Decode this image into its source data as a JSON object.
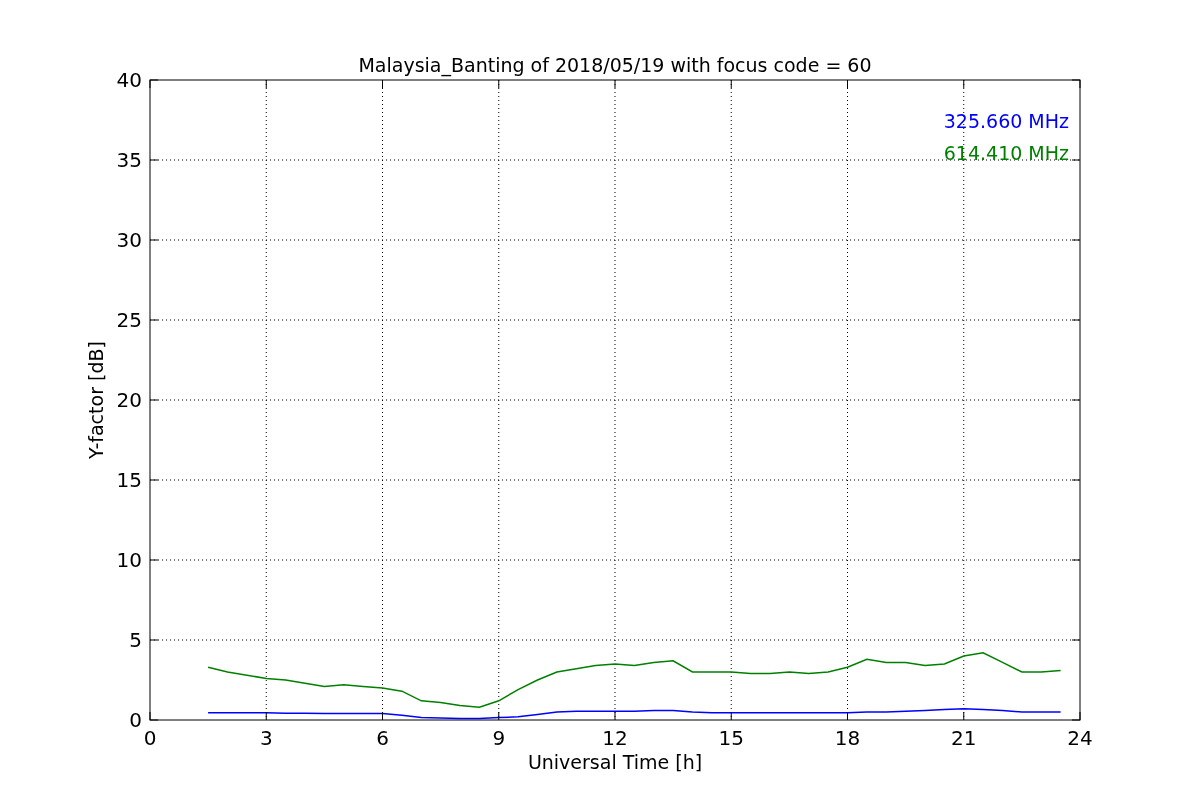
{
  "chart_data": {
    "type": "line",
    "title": "Malaysia_Banting of 2018/05/19 with focus code = 60",
    "xlabel": "Universal Time [h]",
    "ylabel": "Y-factor [dB]",
    "x": [
      1.5,
      2,
      2.5,
      3,
      3.5,
      4,
      4.5,
      5,
      5.5,
      6,
      6.5,
      7,
      7.5,
      8,
      8.5,
      9,
      9.5,
      10,
      10.5,
      11,
      11.5,
      12,
      12.5,
      13,
      13.5,
      14,
      14.5,
      15,
      15.5,
      16,
      16.5,
      17,
      17.5,
      18,
      18.5,
      19,
      19.5,
      20,
      20.5,
      21,
      21.5,
      22,
      22.5,
      23,
      23.5
    ],
    "series": [
      {
        "name": "325.660 MHz",
        "color": "#0000ff",
        "values": [
          0.45,
          0.45,
          0.45,
          0.45,
          0.42,
          0.42,
          0.4,
          0.4,
          0.4,
          0.4,
          0.3,
          0.15,
          0.12,
          0.1,
          0.1,
          0.15,
          0.2,
          0.35,
          0.5,
          0.55,
          0.55,
          0.55,
          0.55,
          0.6,
          0.6,
          0.5,
          0.45,
          0.45,
          0.45,
          0.45,
          0.45,
          0.45,
          0.45,
          0.45,
          0.5,
          0.5,
          0.55,
          0.6,
          0.65,
          0.7,
          0.65,
          0.6,
          0.5,
          0.5,
          0.5
        ]
      },
      {
        "name": "614.410 MHz",
        "color": "#008000",
        "values": [
          3.3,
          3.0,
          2.8,
          2.6,
          2.5,
          2.3,
          2.1,
          2.2,
          2.1,
          2.0,
          1.8,
          1.2,
          1.1,
          0.9,
          0.8,
          1.2,
          1.9,
          2.5,
          3.0,
          3.2,
          3.4,
          3.5,
          3.4,
          3.6,
          3.7,
          3.0,
          3.0,
          3.0,
          2.9,
          2.9,
          3.0,
          2.9,
          3.0,
          3.3,
          3.8,
          3.6,
          3.6,
          3.4,
          3.5,
          4.0,
          4.2,
          3.6,
          3.0,
          3.0,
          3.1
        ]
      }
    ],
    "grid": true,
    "xlim": [
      0,
      24
    ],
    "ylim": [
      0,
      40
    ],
    "xticks": [
      0,
      3,
      6,
      9,
      12,
      15,
      18,
      21,
      24
    ],
    "yticks": [
      0,
      5,
      10,
      15,
      20,
      25,
      30,
      35,
      40
    ]
  }
}
